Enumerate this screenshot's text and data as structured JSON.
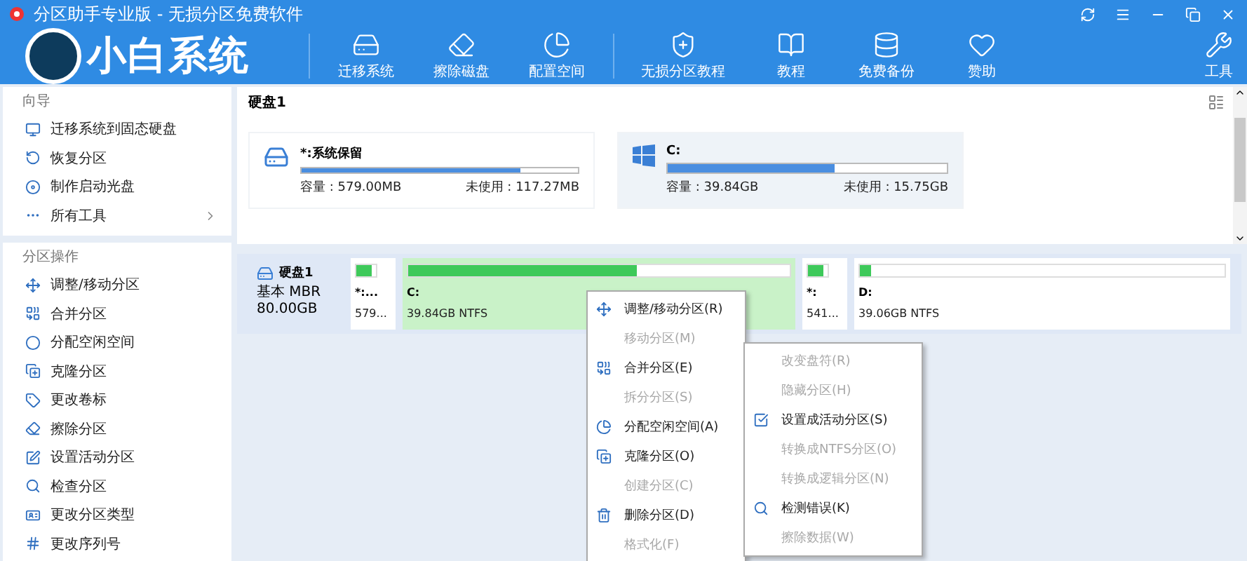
{
  "window": {
    "title": "分区助手专业版 - 无损分区免费软件"
  },
  "logo": {
    "text": "小白系统"
  },
  "toolbar": [
    {
      "label": "迁移系统"
    },
    {
      "label": "擦除磁盘"
    },
    {
      "label": "配置空间"
    },
    {
      "label": "无损分区教程"
    },
    {
      "label": "教程"
    },
    {
      "label": "免费备份"
    },
    {
      "label": "赞助"
    }
  ],
  "tools_button": {
    "label": "工具"
  },
  "sidebar": {
    "sections": [
      {
        "title": "向导",
        "items": [
          {
            "label": "迁移系统到固态硬盘"
          },
          {
            "label": "恢复分区"
          },
          {
            "label": "制作启动光盘"
          },
          {
            "label": "所有工具",
            "expandable": true
          }
        ]
      },
      {
        "title": "分区操作",
        "items": [
          {
            "label": "调整/移动分区"
          },
          {
            "label": "合并分区"
          },
          {
            "label": "分配空闲空间"
          },
          {
            "label": "克隆分区"
          },
          {
            "label": "更改卷标"
          },
          {
            "label": "擦除分区"
          },
          {
            "label": "设置活动分区"
          },
          {
            "label": "检查分区"
          },
          {
            "label": "更改分区类型"
          },
          {
            "label": "更改序列号"
          }
        ]
      }
    ]
  },
  "disk_panel": {
    "title": "硬盘1",
    "cards": [
      {
        "name": "*:系统保留",
        "level": 0.79,
        "capacity": "容量 : 579.00MB",
        "free": "未使用 : 117.27MB",
        "selected": false
      },
      {
        "name": "C:",
        "level": 0.6,
        "capacity": "容量 : 39.84GB",
        "free": "未使用 : 15.75GB",
        "selected": true
      }
    ]
  },
  "disk_map": {
    "name": "硬盘1",
    "type": "基本 MBR",
    "size": "80.00GB",
    "partitions": [
      {
        "name": "*:...",
        "size": "579...",
        "level": 0.8,
        "selected": false
      },
      {
        "name": "C:",
        "size": "39.84GB NTFS",
        "level": 0.6,
        "selected": true
      },
      {
        "name": "*:",
        "size": "541...",
        "level": 0.8,
        "selected": false
      },
      {
        "name": "D:",
        "size": "39.06GB NTFS",
        "level": 0.03,
        "selected": false
      }
    ]
  },
  "context_menu": [
    {
      "label": "调整/移动分区(R)",
      "disabled": false
    },
    {
      "label": "移动分区(M)",
      "disabled": true
    },
    {
      "label": "合并分区(E)",
      "disabled": false
    },
    {
      "label": "拆分分区(S)",
      "disabled": true
    },
    {
      "label": "分配空闲空间(A)",
      "disabled": false
    },
    {
      "label": "克隆分区(O)",
      "disabled": false
    },
    {
      "label": "创建分区(C)",
      "disabled": true
    },
    {
      "label": "删除分区(D)",
      "disabled": false
    },
    {
      "label": "格式化(F)",
      "disabled": true
    }
  ],
  "submenu": [
    {
      "label": "改变盘符(R)",
      "disabled": true
    },
    {
      "label": "隐藏分区(H)",
      "disabled": true
    },
    {
      "label": "设置成活动分区(S)",
      "disabled": false
    },
    {
      "label": "转换成NTFS分区(O)",
      "disabled": true
    },
    {
      "label": "转换成逻辑分区(N)",
      "disabled": true
    },
    {
      "label": "检测错误(K)",
      "disabled": false
    },
    {
      "label": "擦除数据(W)",
      "disabled": true
    }
  ]
}
